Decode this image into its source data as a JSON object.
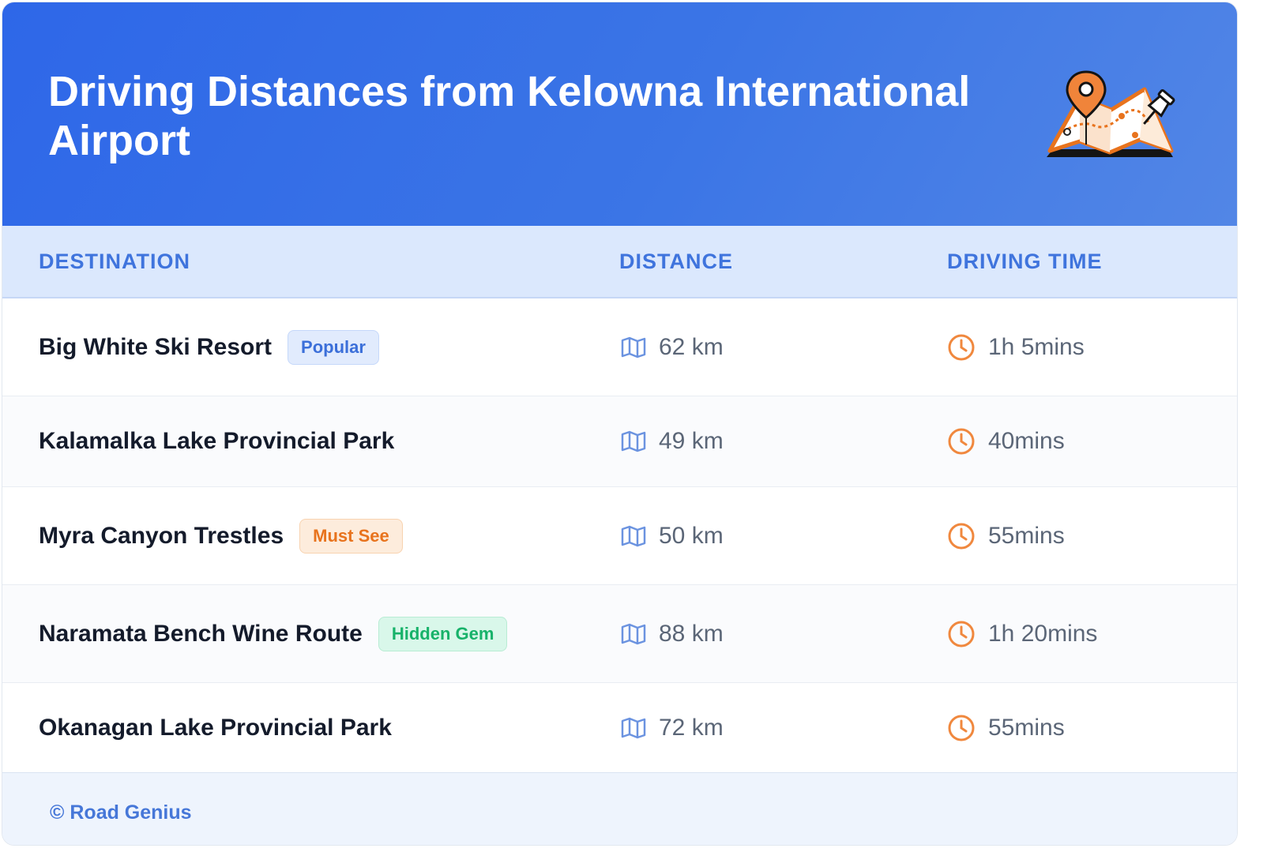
{
  "header": {
    "title": "Driving Distances from Kelowna International Airport",
    "icon": "map-pin-icon",
    "background_color": "#2e67e8"
  },
  "table": {
    "columns": [
      "DESTINATION",
      "DISTANCE",
      "DRIVING TIME"
    ],
    "rows": [
      {
        "destination": "Big White Ski Resort",
        "badge": "Popular",
        "badge_color": "blue",
        "distance": "62 km",
        "time": "1h 5mins"
      },
      {
        "destination": "Kalamalka Lake Provincial Park",
        "badge": "",
        "badge_color": "",
        "distance": "49 km",
        "time": "40mins"
      },
      {
        "destination": "Myra Canyon Trestles",
        "badge": "Must See",
        "badge_color": "orange",
        "distance": "50 km",
        "time": "55mins"
      },
      {
        "destination": "Naramata Bench Wine Route",
        "badge": "Hidden Gem",
        "badge_color": "green",
        "distance": "88 km",
        "time": "1h 20mins"
      },
      {
        "destination": "Okanagan Lake Provincial Park",
        "badge": "",
        "badge_color": "",
        "distance": "72 km",
        "time": "55mins"
      }
    ],
    "distance_icon": "map-icon",
    "time_icon": "clock-icon"
  },
  "footer": {
    "credit": "© Road Genius"
  },
  "colors": {
    "accent": "#3f74dd",
    "clock": "#f0883e",
    "map": "#6b93e0"
  }
}
